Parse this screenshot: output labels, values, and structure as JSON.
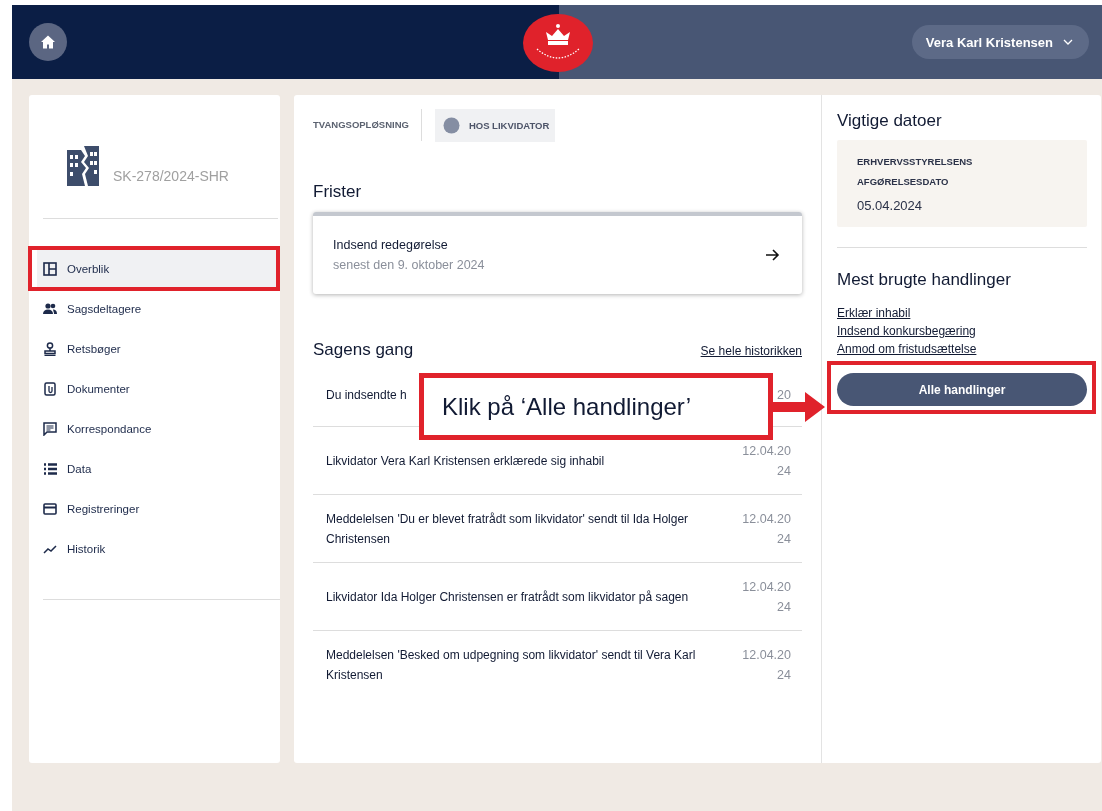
{
  "header": {
    "user": "Vera Karl Kristensen"
  },
  "case": {
    "number": "SK-278/2024-SHR"
  },
  "sidebar": {
    "items": [
      {
        "label": "Overblik",
        "selected": true
      },
      {
        "label": "Sagsdeltagere",
        "selected": false
      },
      {
        "label": "Retsbøger",
        "selected": false
      },
      {
        "label": "Dokumenter",
        "selected": false
      },
      {
        "label": "Korrespondance",
        "selected": false
      },
      {
        "label": "Data",
        "selected": false
      },
      {
        "label": "Registreringer",
        "selected": false
      },
      {
        "label": "Historik",
        "selected": false
      }
    ]
  },
  "status": {
    "type": "TVANGSOPLØSNING",
    "state": "HOS LIKVIDATOR"
  },
  "deadlines": {
    "title": "Frister",
    "items": [
      {
        "title": "Indsend redegørelse",
        "subtitle": "senest den 9. oktober 2024"
      }
    ]
  },
  "history": {
    "title": "Sagens gang",
    "link": "Se hele historikken",
    "rows": [
      {
        "text": "Du indsendte h",
        "date": [
          "20"
        ]
      },
      {
        "text": "Likvidator Vera Karl Kristensen erklærede sig inhabil",
        "date": [
          "12.04.20",
          "24"
        ]
      },
      {
        "text": "Meddelelsen 'Du er blevet fratrådt som likvidator' sendt til Ida Holger Christensen",
        "date": [
          "12.04.20",
          "24"
        ]
      },
      {
        "text": "Likvidator Ida Holger Christensen er fratrådt som likvidator på sagen",
        "date": [
          "12.04.20",
          "24"
        ]
      },
      {
        "text": "Meddelelsen 'Besked om udpegning som likvidator' sendt til Vera Karl Kristensen",
        "date": [
          "12.04.20",
          "24"
        ]
      }
    ]
  },
  "important_dates": {
    "title": "Vigtige datoer",
    "items": [
      {
        "label": "ERHVERVSSTYRELSENS AFGØRELSESDATO",
        "value": "05.04.2024"
      }
    ]
  },
  "actions": {
    "title": "Mest brugte handlinger",
    "links": [
      "Erklær inhabil",
      "Indsend konkursbegæring",
      "Anmod om fristudsættelse"
    ],
    "button": "Alle handlinger"
  },
  "annotation": {
    "callout": "Klik på ‘Alle handlinger’"
  }
}
